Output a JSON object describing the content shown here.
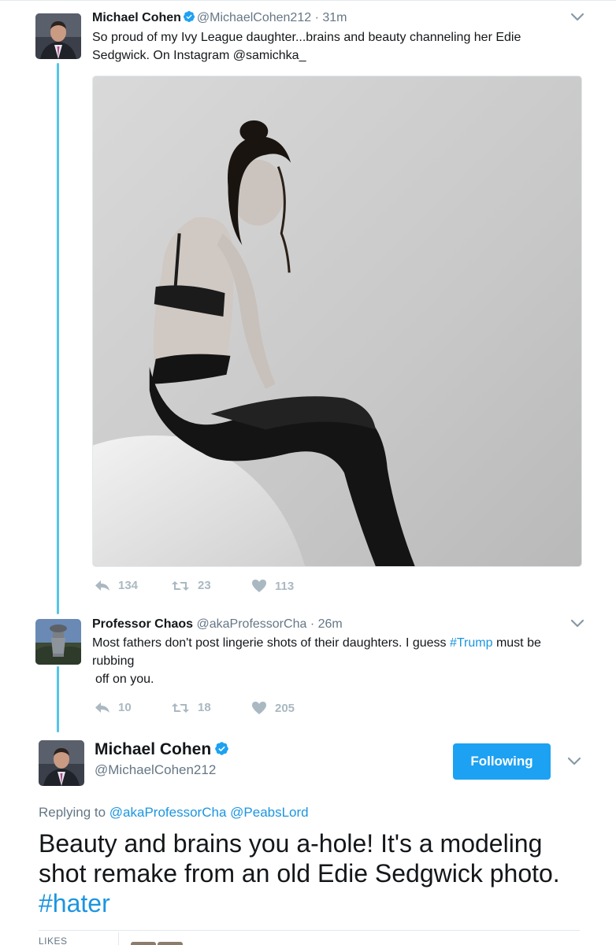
{
  "tweet1": {
    "name": "Michael Cohen",
    "handle": "@MichaelCohen212",
    "separator": "·",
    "time": "31m",
    "text": "So proud of my Ivy League daughter...brains and beauty channeling her Edie Sedgwick. On Instagram @samichka_",
    "reply_count": "134",
    "retweet_count": "23",
    "like_count": "113"
  },
  "tweet2": {
    "name": "Professor Chaos",
    "handle": "@akaProfessorCha",
    "separator": "·",
    "time": "26m",
    "text_before": "Most fathers don't post lingerie shots of their daughters. I guess ",
    "hashtag": "#Trump",
    "text_after": " must be",
    "text_line2": "rubbing",
    "text_line3": "off on you.",
    "reply_count": "10",
    "retweet_count": "18",
    "like_count": "205"
  },
  "main_tweet": {
    "name": "Michael Cohen",
    "handle": "@MichaelCohen212",
    "follow_label": "Following",
    "replying_prefix": "Replying to",
    "replying_to_1": "@akaProfessorCha",
    "replying_to_2": "@PeabsLord",
    "text": "Beauty and brains you a-hole! It's a modeling shot remake from an old Edie Sedgwick photo.",
    "hashtag": "#hater",
    "likes_label": "LIKES"
  },
  "colors": {
    "accent": "#1da1f2",
    "link": "#1b95e0",
    "thread_line": "#55c5e8",
    "muted": "#657786",
    "action_icon": "#aab8c2"
  },
  "icons": [
    "verified-badge-icon",
    "chevron-down-icon",
    "reply-icon",
    "retweet-icon",
    "heart-icon"
  ]
}
